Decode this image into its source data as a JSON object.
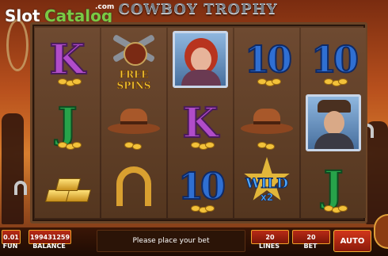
{
  "logo": {
    "slot": "Slot",
    "catalog": "Catalog",
    "com": ".com"
  },
  "title": "COWBOY TROPHY",
  "reels": [
    [
      "K",
      "J",
      "gold-bars"
    ],
    [
      "free-spins",
      "cowboy-hat",
      "horseshoe"
    ],
    [
      "woman-portrait",
      "K",
      "10"
    ],
    [
      "10",
      "cowboy-hat",
      "wild"
    ],
    [
      "10",
      "sheriff-portrait",
      "J"
    ]
  ],
  "symbols": {
    "free_spins": "FREE SPINS",
    "wild": "WILD",
    "wild_mult": "x2"
  },
  "bottom": {
    "fun_value": "0.01",
    "fun_label": "FUN",
    "balance_value": "199431259",
    "balance_label": "BALANCE",
    "message": "Please place your bet",
    "lines_value": "20",
    "lines_label": "LINES",
    "bet_value": "20",
    "bet_label": "BET",
    "auto": "AUTO"
  }
}
